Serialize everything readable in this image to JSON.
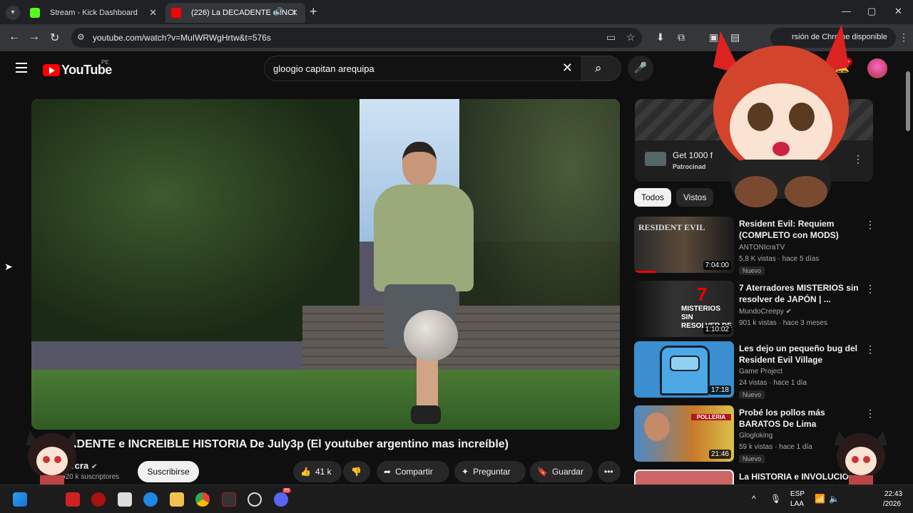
{
  "browser": {
    "tabs": [
      {
        "title": "Stream - Kick Dashboard",
        "favicon_color": "#53fc18"
      },
      {
        "title": "(226) La DECADENTE e INCI",
        "favicon_color": "#ff0000"
      }
    ],
    "url": "youtube.com/watch?v=MuIWRWgHrtw&t=576s",
    "update_label": "rsión de Chrome disponible"
  },
  "youtube": {
    "logo_text": "YouTube",
    "region": "PE",
    "search_query": "gloogio capitan arequipa",
    "notification_count": "9+"
  },
  "video": {
    "title": "ADENTE e INCREIBLE HISTORIA De July3p (El youtuber argentino mas increíble)",
    "channel": "ircra",
    "subscribers": "920 k suscriptores",
    "subscribe_label": "Suscribirse",
    "likes": "41 k",
    "share_label": "Compartir",
    "ask_label": "Preguntar",
    "save_label": "Guardar"
  },
  "ad": {
    "title": "Get 1000 f",
    "sponsor": "Patrocinad"
  },
  "filters": {
    "all": "Todos",
    "watched": "Vistos"
  },
  "recommendations": [
    {
      "title": "Resident Evil: Requiem (COMPLETO con MODS)",
      "channel": "ANTONIcraTV",
      "meta": "5,8 K vistas · hace 5 días",
      "badge": "Nuevo",
      "duration": "7:04:00",
      "thumb_text": "RESIDENT EVIL"
    },
    {
      "title": "7 Aterradores MISTERIOS sin resolver de JAPÓN | ...",
      "channel": "MundoCreepy",
      "meta": "901 k vistas · hace 3 meses",
      "badge": "",
      "duration": "1:10:02",
      "thumb_text": "MISTERIOS SIN RESOLVER DE"
    },
    {
      "title": "Les dejo un pequeño bug del Resident Evil Village",
      "channel": "Game Project",
      "meta": "24 vistas · hace 1 día",
      "badge": "Nuevo",
      "duration": "17:18",
      "thumb_text": ""
    },
    {
      "title": "Probé los pollos más BARATOS De Lima",
      "channel": "Glogloking",
      "meta": "59 k vistas · hace 1 día",
      "badge": "Nuevo",
      "duration": "21:46",
      "thumb_text": "POLLERIA"
    },
    {
      "title": "La HISTORIA e INVOLUCION",
      "channel": "",
      "meta": "",
      "badge": "",
      "duration": "",
      "thumb_text": ""
    }
  ],
  "taskbar": {
    "lang": "ESP",
    "layout": "LAA",
    "time": "22:43",
    "date": "/2026",
    "discord_badge": "99"
  }
}
